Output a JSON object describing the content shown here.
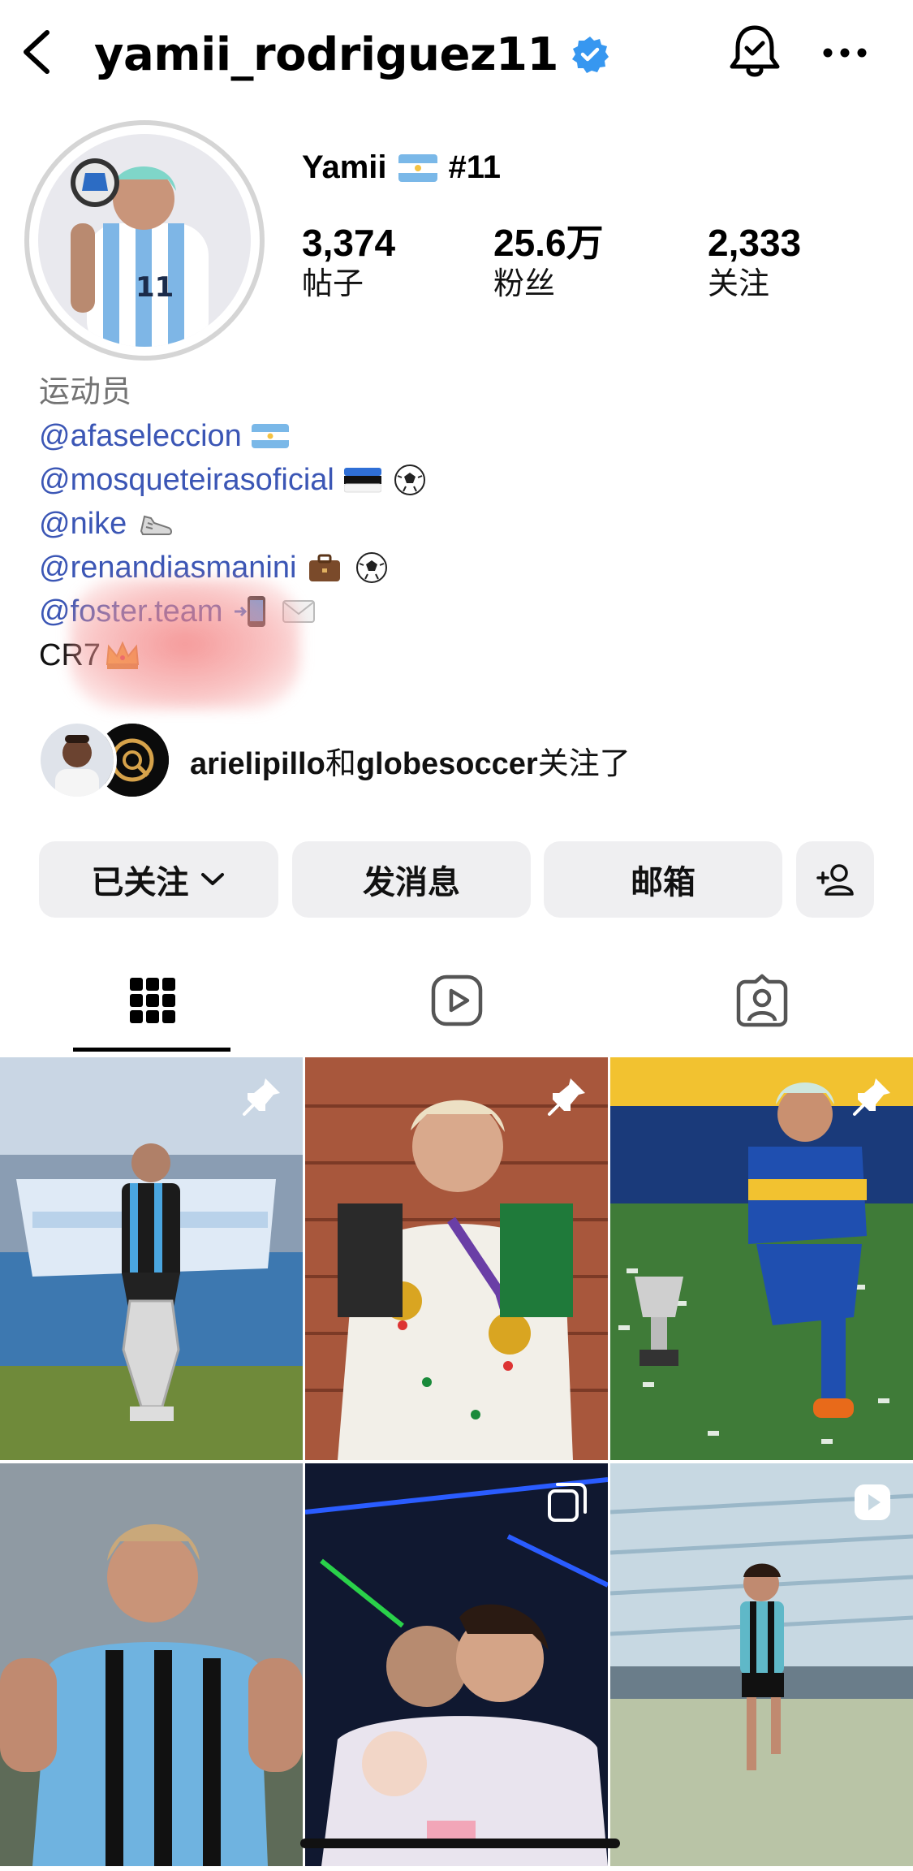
{
  "header": {
    "username": "yamii_rodriguez11",
    "verified_icon": "verified-badge-icon",
    "accent": "#3797f0"
  },
  "profile": {
    "display_name": "Yamii",
    "display_suffix": "#11",
    "stats": [
      {
        "value": "3,374",
        "label": "帖子"
      },
      {
        "value": "25.6万",
        "label": "粉丝"
      },
      {
        "value": "2,333",
        "label": "关注"
      }
    ]
  },
  "bio": {
    "category": "运动员",
    "links": [
      {
        "text": "@afaseleccion",
        "emoji": "argentina-flag-icon"
      },
      {
        "text": "@mosqueteirasoficial",
        "emoji": "estonia-flag-icon"
      },
      {
        "text": "@nike",
        "emoji": "sneaker-icon"
      },
      {
        "text": "@renandiasmanini",
        "emoji": "briefcase-icon"
      },
      {
        "text": "@foster.team",
        "emoji": "phone-icon"
      }
    ],
    "last_line": "CR7",
    "link_color": "#3b56b5"
  },
  "followed_by": {
    "user1": "arielipillo",
    "conj": "和",
    "user2": "globesoccer",
    "suffix": "关注了"
  },
  "actions": {
    "following": "已关注",
    "message": "发消息",
    "email": "邮箱"
  },
  "tabs": [
    "grid-icon",
    "reels-icon",
    "tagged-icon"
  ],
  "grid": [
    {
      "type": "pinned"
    },
    {
      "type": "pinned"
    },
    {
      "type": "pinned"
    },
    {
      "type": "post"
    },
    {
      "type": "carousel"
    },
    {
      "type": "reel"
    }
  ]
}
